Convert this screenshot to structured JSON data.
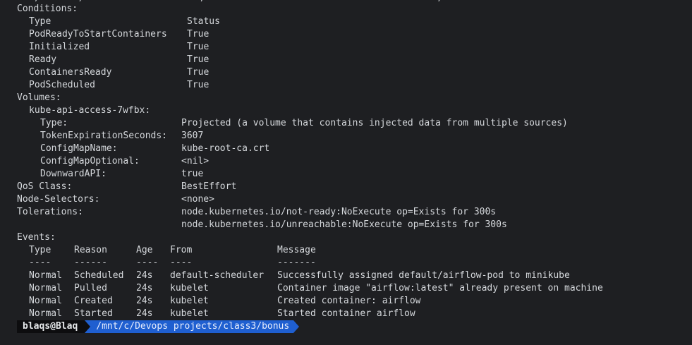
{
  "top_fragment": ".  ,       ,                     ,                    .                     ,  .",
  "conditions": {
    "heading": "Conditions:",
    "header_type": "Type",
    "header_status": "Status",
    "rows": [
      {
        "type": "PodReadyToStartContainers",
        "status": "True"
      },
      {
        "type": "Initialized",
        "status": "True"
      },
      {
        "type": "Ready",
        "status": "True"
      },
      {
        "type": "ContainersReady",
        "status": "True"
      },
      {
        "type": "PodScheduled",
        "status": "True"
      }
    ]
  },
  "volumes": {
    "heading": "Volumes:",
    "name": "kube-api-access-7wfbx:",
    "fields": [
      {
        "key": "Type:",
        "value": "Projected (a volume that contains injected data from multiple sources)"
      },
      {
        "key": "TokenExpirationSeconds:",
        "value": "3607"
      },
      {
        "key": "ConfigMapName:",
        "value": "kube-root-ca.crt"
      },
      {
        "key": "ConfigMapOptional:",
        "value": "<nil>"
      },
      {
        "key": "DownwardAPI:",
        "value": "true"
      }
    ]
  },
  "qos": {
    "key": "QoS Class:",
    "value": "BestEffort"
  },
  "node_selectors": {
    "key": "Node-Selectors:",
    "value": "<none>"
  },
  "tolerations": {
    "key": "Tolerations:",
    "values": [
      "node.kubernetes.io/not-ready:NoExecute op=Exists for 300s",
      "node.kubernetes.io/unreachable:NoExecute op=Exists for 300s"
    ]
  },
  "events": {
    "heading": "Events:",
    "headers": [
      "Type",
      "Reason",
      "Age",
      "From",
      "Message"
    ],
    "separators": [
      "----",
      "------",
      "----",
      "----",
      "-------"
    ],
    "rows": [
      [
        "Normal",
        "Scheduled",
        "24s",
        "default-scheduler",
        "Successfully assigned default/airflow-pod to minikube"
      ],
      [
        "Normal",
        "Pulled",
        "24s",
        "kubelet",
        "Container image \"airflow:latest\" already present on machine"
      ],
      [
        "Normal",
        "Created",
        "24s",
        "kubelet",
        "Created container: airflow"
      ],
      [
        "Normal",
        "Started",
        "24s",
        "kubelet",
        "Started container airflow"
      ]
    ]
  },
  "prompt": {
    "user": "blaqs@Blaq",
    "path": "/mnt/c/Devops projects/class3/bonus"
  },
  "colors": {
    "background": "#1e1f22",
    "text": "#d5d8dc",
    "prompt_user_bg": "#0d0d0f",
    "prompt_path_bg": "#1f5fd0"
  }
}
